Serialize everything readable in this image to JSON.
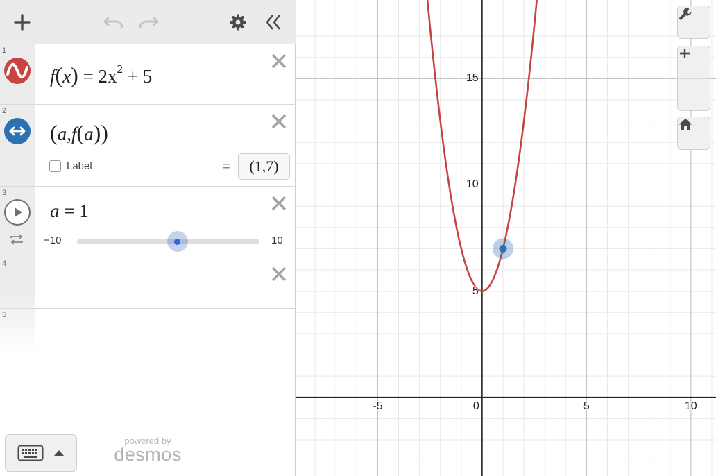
{
  "toolbar": {
    "add_icon": "plus-icon",
    "undo_icon": "undo-icon",
    "redo_icon": "redo-icon",
    "settings_icon": "gear-icon",
    "collapse_icon": "double-chevron-left-icon"
  },
  "expressions": [
    {
      "number": "1",
      "icon": "wave-icon",
      "color": "#c74440",
      "latex_parts": {
        "name": "f",
        "var": "x",
        "equals": "=",
        "coef": "2x",
        "exp": "2",
        "rest": "+ 5"
      }
    },
    {
      "number": "2",
      "icon": "point-arrows-icon",
      "color": "#2d70b3",
      "latex_parts": {
        "open": "(",
        "a": "a",
        "comma": ",",
        "f": "f",
        "inner_open": "(",
        "inner_a": "a",
        "inner_close": ")",
        "close": ")"
      },
      "label_text": "Label",
      "label_checked": false,
      "result_equals": "=",
      "result": "(1,7)"
    },
    {
      "number": "3",
      "icon": "play-icon",
      "latex_parts": {
        "var": "a",
        "equals": "=",
        "value": "1"
      },
      "slider": {
        "min": "−10",
        "max": "10",
        "value": 1,
        "min_value": -10,
        "max_value": 10
      }
    },
    {
      "number": "4"
    },
    {
      "number": "5"
    }
  ],
  "footer": {
    "keyboard_icon": "keyboard-icon",
    "powered_by": "powered by",
    "brand": "desmos"
  },
  "graph_tools": {
    "wrench_icon": "wrench-icon",
    "zoom_in_icon": "plus-icon",
    "zoom_out_icon": "minus-icon",
    "home_icon": "home-icon"
  },
  "chart_data": {
    "type": "line",
    "xlim": [
      -8.9,
      11.2
    ],
    "ylim": [
      -3.7,
      18.7
    ],
    "x_ticks": [
      -5,
      0,
      5,
      10
    ],
    "x_tick_labels": [
      "-5",
      "0",
      "5",
      "10"
    ],
    "y_ticks": [
      5,
      10,
      15
    ],
    "y_tick_labels": [
      "5",
      "10",
      "15"
    ],
    "grid": true,
    "series": [
      {
        "curve": "quadratic",
        "coefficients": {
          "a": 2,
          "b": 0,
          "c": 5
        },
        "color": "#c74440"
      }
    ],
    "points": [
      {
        "x": 1,
        "y": 7,
        "color": "#2d70b3"
      }
    ]
  }
}
